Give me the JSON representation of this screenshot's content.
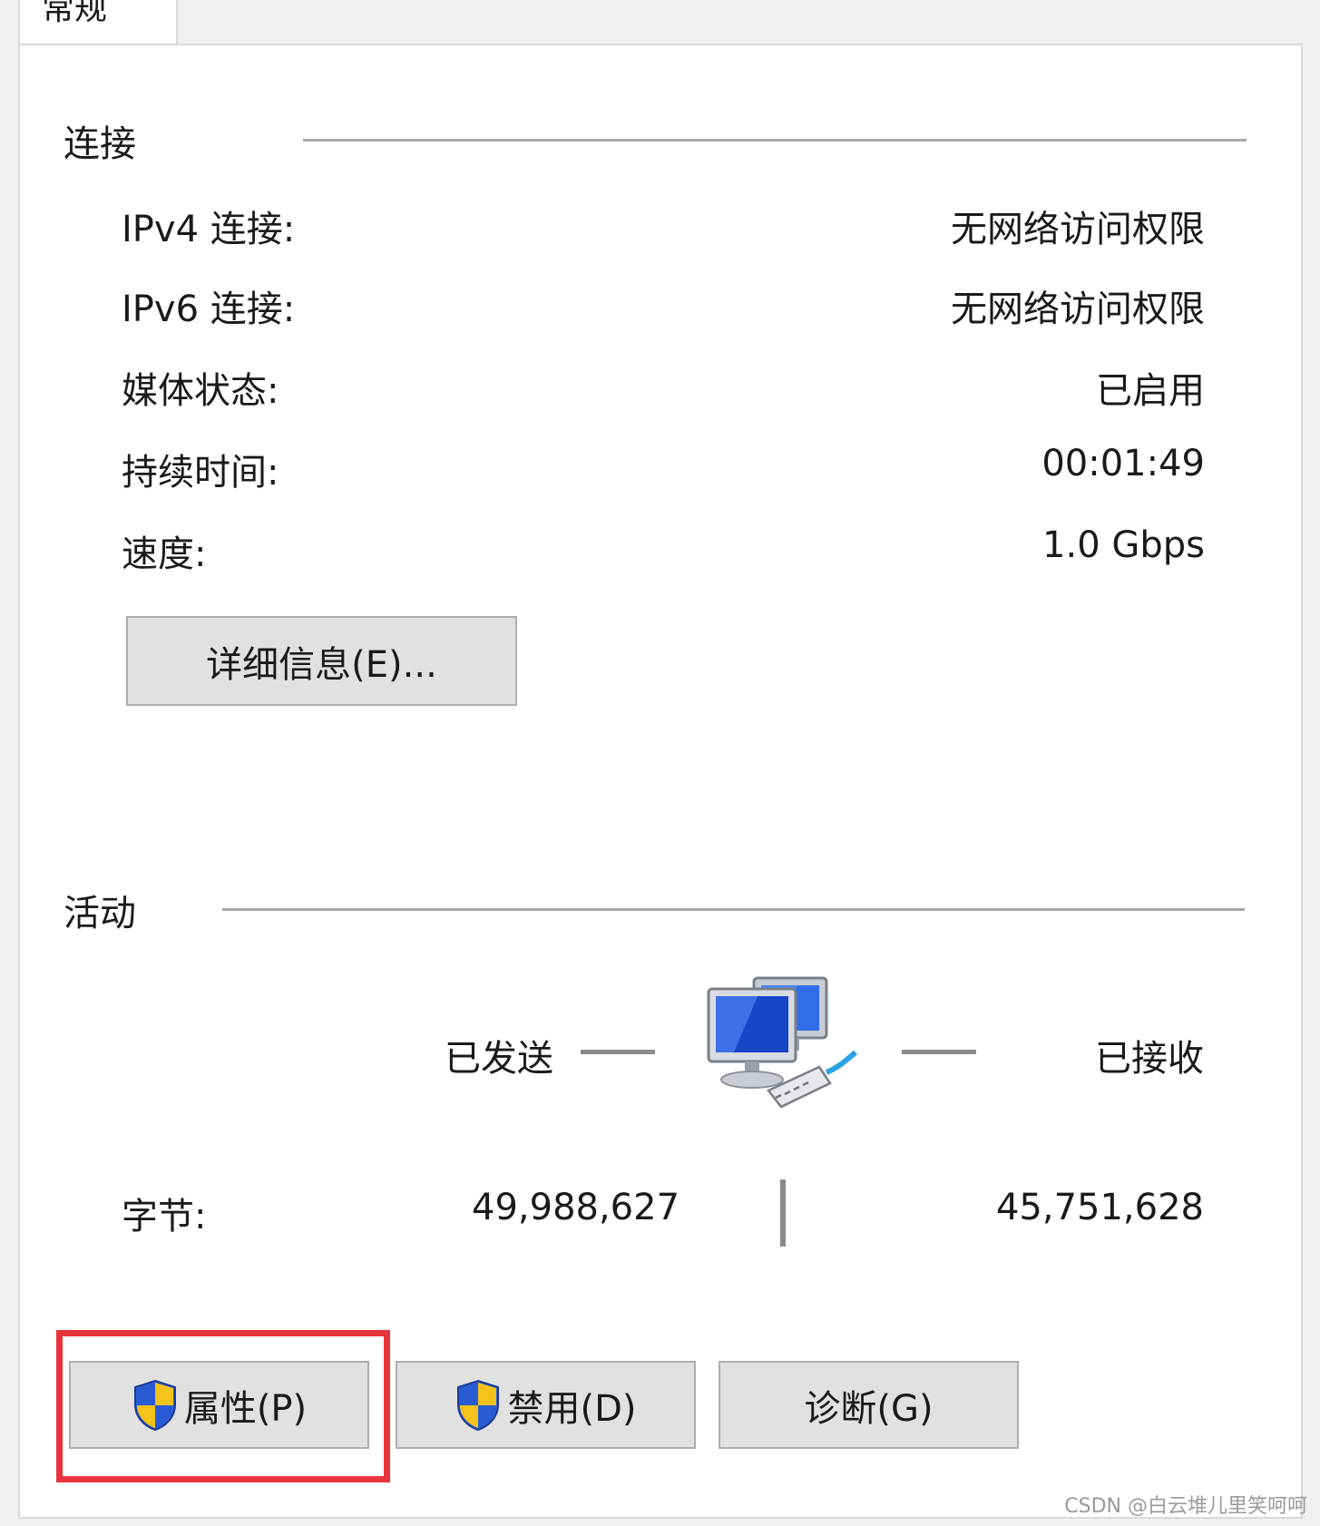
{
  "tab": {
    "label": "常规"
  },
  "connection": {
    "title": "连接",
    "rows": [
      {
        "label": "IPv4 连接:",
        "value": "无网络访问权限"
      },
      {
        "label": "IPv6 连接:",
        "value": "无网络访问权限"
      },
      {
        "label": "媒体状态:",
        "value": "已启用"
      },
      {
        "label": "持续时间:",
        "value": "00:01:49"
      },
      {
        "label": "速度:",
        "value": "1.0 Gbps"
      }
    ],
    "details_button": "详细信息(E)..."
  },
  "activity": {
    "title": "活动",
    "sent_label": "已发送",
    "received_label": "已接收",
    "bytes_label": "字节:",
    "bytes_sent": "49,988,627",
    "bytes_received": "45,751,628",
    "icon": "network-computers-icon"
  },
  "buttons": {
    "properties": "属性(P)",
    "disable": "禁用(D)",
    "diagnose": "诊断(G)"
  },
  "watermark": "CSDN @白云堆儿里笑呵呵",
  "colors": {
    "highlight": "#e8353b",
    "shield_blue": "#2a5bd7",
    "shield_yellow": "#f3c21b"
  }
}
